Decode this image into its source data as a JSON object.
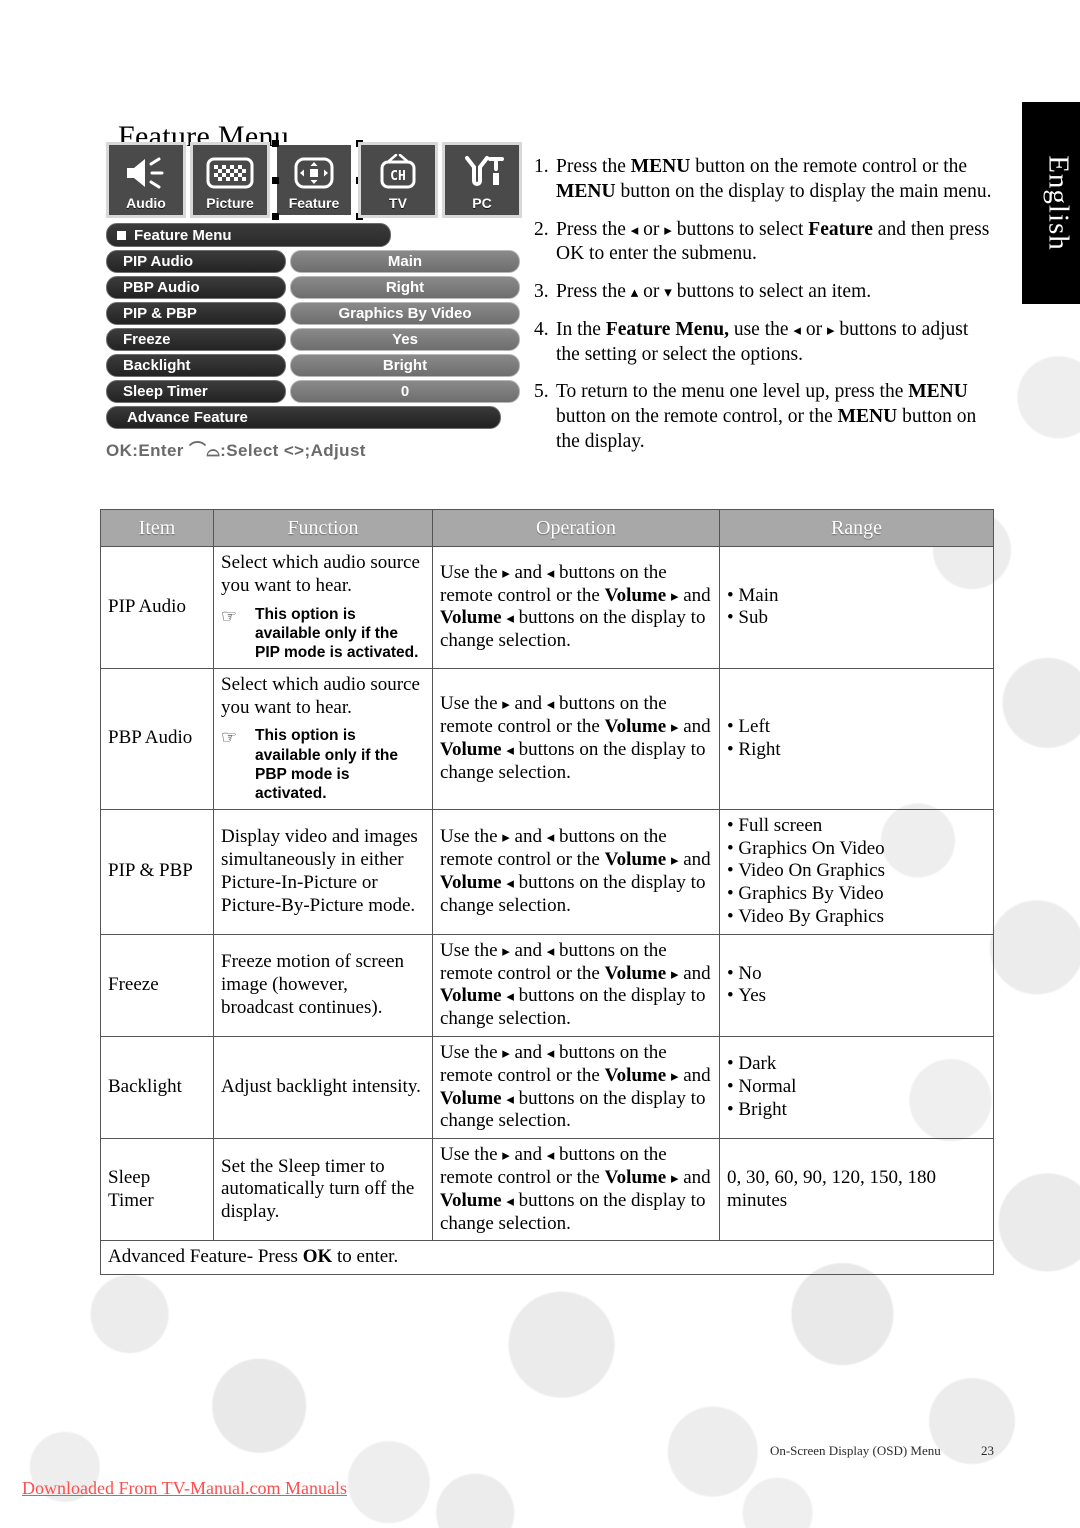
{
  "page_title": "Feature Menu",
  "language_tab": "English",
  "osd": {
    "icons": [
      {
        "label": "Audio",
        "icon": "speaker-icon",
        "selected": false
      },
      {
        "label": "Picture",
        "icon": "checkerboard-icon",
        "selected": false
      },
      {
        "label": "Feature",
        "icon": "four-way-arrows-icon",
        "selected": true
      },
      {
        "label": "TV",
        "icon": "tv-channel-icon",
        "selected": false
      },
      {
        "label": "PC",
        "icon": "wrench-tools-icon",
        "selected": false
      }
    ],
    "menu_title": "Feature Menu",
    "rows": [
      {
        "label": "PIP Audio",
        "value": "Main"
      },
      {
        "label": "PBP Audio",
        "value": "Right"
      },
      {
        "label": "PIP & PBP",
        "value": "Graphics By Video"
      },
      {
        "label": "Freeze",
        "value": "Yes"
      },
      {
        "label": "Backlight",
        "value": "Bright"
      },
      {
        "label": "Sleep Timer",
        "value": "0"
      }
    ],
    "advance_row": "Advance Feature",
    "hint": "OK:Enter  ⌒⌓:Select  <>;Adjust"
  },
  "steps": [
    {
      "num": "1.",
      "html": "Press the <span class=\"b\">MENU</span> button on the remote control or the <span class=\"b\">MENU</span> button on the display to display the main menu."
    },
    {
      "num": "2.",
      "html": "Press the <span class=\"ar\">◂</span> or <span class=\"ar\">▸</span> buttons to select <span class=\"b\">Feature</span> and then press OK to enter the submenu."
    },
    {
      "num": "3.",
      "html": "Press the <span class=\"ar\">▴</span> or <span class=\"ar\">▾</span> buttons to select an item."
    },
    {
      "num": "4.",
      "html": "In the <span class=\"b\">Feature Menu,</span> use the <span class=\"ar\">◂</span> or <span class=\"ar\">▸</span> buttons to adjust the setting or select the options."
    },
    {
      "num": "5.",
      "html": "To return to the menu one level up, press the <span class=\"b\">MENU</span> button on the remote control, or the <span class=\"b\">MENU</span> button on the display."
    }
  ],
  "table": {
    "headers": [
      "Item",
      "Function",
      "Operation",
      "Range"
    ],
    "rows": [
      {
        "item": "PIP Audio",
        "function": "Select which audio source you want to hear.",
        "note": "This option is available only if the PIP mode is activated.",
        "operation": "Use the <span class=\"ar\">▸</span> and <span class=\"ar\">◂</span> buttons on the remote control or the <span class=\"b\">Volume <span class=\"ar\">▸</span></span> and <span class=\"b\">Volume</span> <span class=\"ar\">◂</span> buttons on the display to change selection.",
        "range": [
          "Main",
          "Sub"
        ]
      },
      {
        "item": "PBP Audio",
        "function": "Select which audio source you want to hear.",
        "note": "This option is available only if the PBP mode is activated.",
        "operation": "Use the <span class=\"ar\">▸</span> and <span class=\"ar\">◂</span> buttons on the remote control or the <span class=\"b\">Volume <span class=\"ar\">▸</span></span> and <span class=\"b\">Volume</span> <span class=\"ar\">◂</span> buttons on the display to change selection.",
        "range": [
          "Left",
          "Right"
        ]
      },
      {
        "item": "PIP & PBP",
        "function": "Display video and images simultaneously in either Picture-In-Picture or Picture-By-Picture mode.",
        "note": "",
        "operation": "Use the <span class=\"ar\">▸</span> and <span class=\"ar\">◂</span> buttons on the remote control or the <span class=\"b\">Volume <span class=\"ar\">▸</span></span> and <span class=\"b\">Volume <span class=\"ar\">◂</span></span> buttons on the display to change selection.",
        "range": [
          "Full screen",
          "Graphics On Video",
          "Video On Graphics",
          "Graphics By Video",
          "Video By Graphics"
        ]
      },
      {
        "item": "Freeze",
        "function": "Freeze motion of screen image (however, broadcast continues).",
        "note": "",
        "operation": "Use the <span class=\"ar\">▸</span> and <span class=\"ar\">◂</span> buttons on the remote control or the <span class=\"b\">Volume <span class=\"ar\">▸</span></span> and <span class=\"b\">Volume</span> <span class=\"ar\">◂</span> buttons on the display to change selection.",
        "range": [
          "No",
          "Yes"
        ]
      },
      {
        "item": "Backlight",
        "function": "Adjust backlight intensity.",
        "note": "",
        "operation": "Use the <span class=\"ar\">▸</span> and <span class=\"ar\">◂</span> buttons on the remote control or the <span class=\"b\">Volume <span class=\"ar\">▸</span></span> and <span class=\"b\">Volume <span class=\"ar\">◂</span></span> buttons on the display to change selection.",
        "range": [
          "Dark",
          "Normal",
          "Bright"
        ]
      },
      {
        "item": "Sleep Timer",
        "function": "Set the Sleep timer to automatically turn off the display.",
        "note": "",
        "operation": "Use the <span class=\"ar\">▸</span> and <span class=\"ar\">◂</span> buttons on the remote control or the <span class=\"b\">Volume <span class=\"ar\">▸</span></span> and <span class=\"b\">Volume <span class=\"ar\">◂</span></span> buttons on the display to change selection.",
        "range_text": " 0, 30, 60, 90, 120, 150, 180 minutes"
      }
    ],
    "footer_row": "Advanced Feature- Press <span class=\"b\">OK</span> to enter."
  },
  "footer": {
    "section": "On-Screen Display (OSD) Menu",
    "page_number": "23"
  },
  "download_note": "Downloaded From TV-Manual.com Manuals",
  "colors": {
    "header_bg": "#a8a8a8",
    "tab_bg": "#000000",
    "link_red": "#ff4d4d",
    "osd_label_bg": "#2f2f2f",
    "osd_value_bg": "#7c7c7c"
  }
}
